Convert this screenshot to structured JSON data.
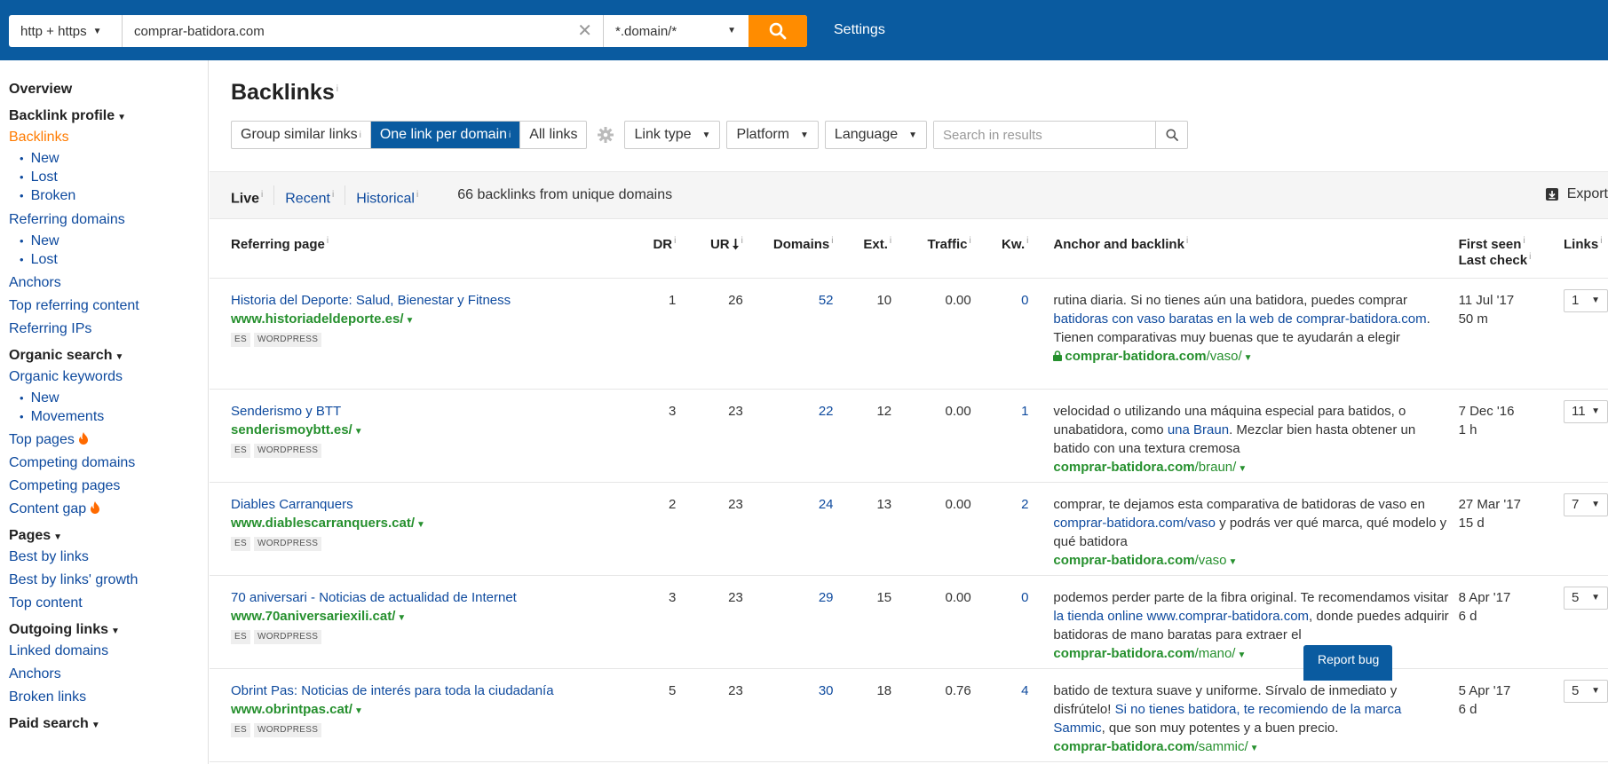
{
  "topbar": {
    "protocol": "http + https",
    "url_value": "comprar-batidora.com",
    "mode": "*.domain/*",
    "settings": "Settings"
  },
  "sidebar": {
    "overview": "Overview",
    "backlink_profile": "Backlink profile",
    "backlinks": "Backlinks",
    "backlinks_sub": [
      "New",
      "Lost",
      "Broken"
    ],
    "referring_domains": "Referring domains",
    "refdomains_sub": [
      "New",
      "Lost"
    ],
    "anchors": "Anchors",
    "top_referring_content": "Top referring content",
    "referring_ips": "Referring IPs",
    "organic_search": "Organic search",
    "organic_keywords": "Organic keywords",
    "organic_sub": [
      "New",
      "Movements"
    ],
    "top_pages": "Top pages",
    "competing_domains": "Competing domains",
    "competing_pages": "Competing pages",
    "content_gap": "Content gap",
    "pages": "Pages",
    "best_by_links": "Best by links",
    "best_by_links_growth": "Best by links' growth",
    "top_content": "Top content",
    "outgoing_links": "Outgoing links",
    "linked_domains": "Linked domains",
    "anchors2": "Anchors",
    "broken_links": "Broken links",
    "paid_search": "Paid search"
  },
  "main": {
    "title": "Backlinks",
    "info": "i",
    "group_similar": "Group similar links",
    "one_per_domain": "One link per domain",
    "all_links": "All links",
    "link_type": "Link type",
    "platform": "Platform",
    "language": "Language",
    "search_placeholder": "Search in results",
    "tab_live": "Live",
    "tab_recent": "Recent",
    "tab_historical": "Historical",
    "count_text": "66 backlinks from unique domains",
    "export": "Export",
    "report_bug": "Report bug"
  },
  "table": {
    "headers": {
      "ref": "Referring page",
      "dr": "DR",
      "ur": "UR",
      "domains": "Domains",
      "ext": "Ext.",
      "traffic": "Traffic",
      "kw": "Kw.",
      "anchor": "Anchor and backlink",
      "first_seen": "First seen",
      "last_check": "Last check",
      "links": "Links"
    },
    "rows": [
      {
        "title": "Historia del Deporte: Salud, Bienestar y Fitness",
        "domain": "www.historiadeldeporte.es/",
        "tag1": "ES",
        "tag2": "WORDPRESS",
        "dr": "1",
        "ur": "26",
        "domains": "52",
        "ext": "10",
        "traffic": "0.00",
        "kw": "0",
        "anchor_pre": "rutina diaria. Si no tienes aún una batidora, puedes comprar ",
        "anchor_link": "batidoras con vaso baratas en la web de comprar-batidora.com",
        "anchor_post": ". Tienen comparativas muy buenas que te ayudarán a elegir",
        "bl_domain": "comprar-batidora.com",
        "bl_path": "/vaso/",
        "first_seen": "11 Jul '17",
        "last_check": "50 m",
        "links": "1"
      },
      {
        "title": "Senderismo y BTT",
        "domain": "senderismoybtt.es/",
        "tag1": "ES",
        "tag2": "WORDPRESS",
        "dr": "3",
        "ur": "23",
        "domains": "22",
        "ext": "12",
        "traffic": "0.00",
        "kw": "1",
        "anchor_pre": "velocidad o utilizando una máquina especial para batidos, o unabatidora, como ",
        "anchor_link": "una Braun",
        "anchor_post": ". Mezclar bien hasta obtener un batido con una textura cremosa",
        "bl_domain": "comprar-batidora.com",
        "bl_path": "/braun/",
        "first_seen": "7 Dec '16",
        "last_check": "1 h",
        "links": "11"
      },
      {
        "title": "Diables Carranquers",
        "domain": "www.diablescarranquers.cat/",
        "tag1": "ES",
        "tag2": "WORDPRESS",
        "dr": "2",
        "ur": "23",
        "domains": "24",
        "ext": "13",
        "traffic": "0.00",
        "kw": "2",
        "anchor_pre": "comprar, te dejamos esta comparativa de batidoras de vaso en ",
        "anchor_link": "comprar-batidora.com/vaso",
        "anchor_post": " y podrás ver qué marca, qué modelo y qué batidora",
        "bl_domain": "comprar-batidora.com",
        "bl_path": "/vaso",
        "first_seen": "27 Mar '17",
        "last_check": "15 d",
        "links": "7"
      },
      {
        "title": "70 aniversari - Noticias de actualidad de Internet",
        "domain": "www.70aniversariexili.cat/",
        "tag1": "ES",
        "tag2": "WORDPRESS",
        "dr": "3",
        "ur": "23",
        "domains": "29",
        "ext": "15",
        "traffic": "0.00",
        "kw": "0",
        "anchor_pre": "podemos perder parte de la fibra original. Te recomendamos visitar ",
        "anchor_link": "la tienda online www.comprar-batidora.com",
        "anchor_post": ", donde puedes adquirir batidoras de mano baratas para extraer el",
        "bl_domain": "comprar-batidora.com",
        "bl_path": "/mano/",
        "first_seen": "8 Apr '17",
        "last_check": "6 d",
        "links": "5"
      },
      {
        "title": "Obrint Pas: Noticias de interés para toda la ciudadanía",
        "domain": "www.obrintpas.cat/",
        "tag1": "ES",
        "tag2": "WORDPRESS",
        "dr": "5",
        "ur": "23",
        "domains": "30",
        "ext": "18",
        "traffic": "0.76",
        "kw": "4",
        "anchor_pre": "batido de textura suave y uniforme. Sírvalo de inmediato y disfrútelo! ",
        "anchor_link": "Si no tienes batidora, te recomiendo de la marca Sammic",
        "anchor_post": ", que son muy potentes y a buen precio.",
        "bl_domain": "comprar-batidora.com",
        "bl_path": "/sammic/",
        "first_seen": "5 Apr '17",
        "last_check": "6 d",
        "links": "5"
      }
    ]
  }
}
